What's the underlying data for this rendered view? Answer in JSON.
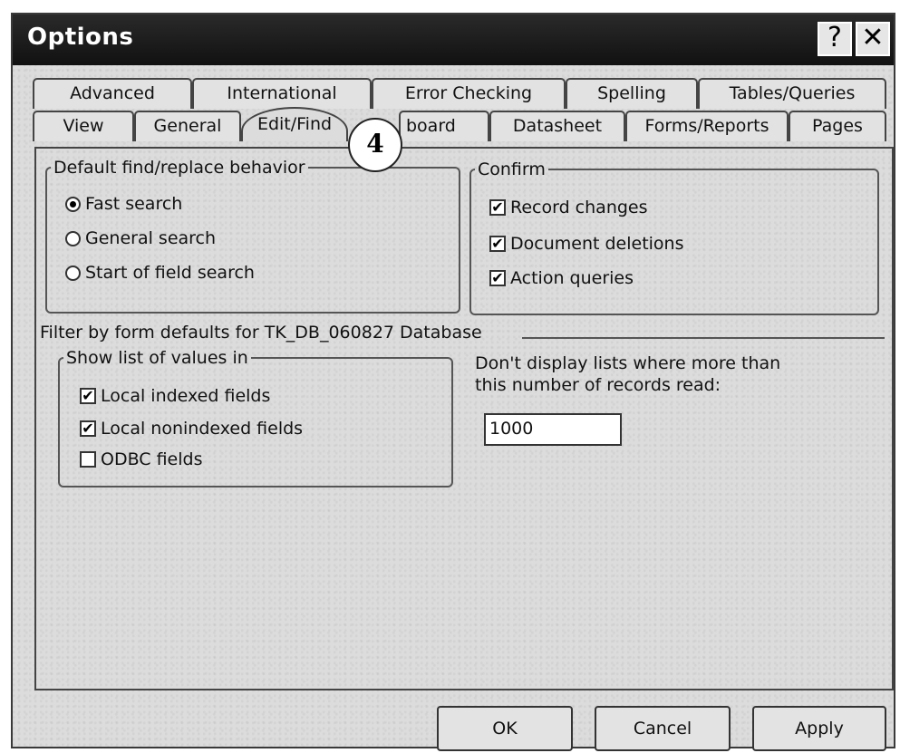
{
  "window": {
    "title": "Options",
    "help_glyph": "?",
    "close_glyph": "✕"
  },
  "tabs": {
    "row1": [
      "Advanced",
      "International",
      "Error Checking",
      "Spelling",
      "Tables/Queries"
    ],
    "row2": [
      "View",
      "General",
      "Edit/Find",
      "Keyboard",
      "Datasheet",
      "Forms/Reports",
      "Pages"
    ],
    "row2_visible": [
      "View",
      "General",
      "Edit/Find",
      "board",
      "Datasheet",
      "Forms/Reports",
      "Pages"
    ],
    "active": "Edit/Find"
  },
  "callout": {
    "number": "4"
  },
  "default_find": {
    "legend": "Default find/replace behavior",
    "options": [
      {
        "label": "Fast search",
        "selected": true
      },
      {
        "label": "General search",
        "selected": false
      },
      {
        "label": "Start of field search",
        "selected": false
      }
    ]
  },
  "confirm": {
    "legend": "Confirm",
    "options": [
      {
        "label": "Record changes",
        "checked": true
      },
      {
        "label": "Document deletions",
        "checked": true
      },
      {
        "label": "Action queries",
        "checked": true
      }
    ]
  },
  "filter": {
    "heading": "Filter by form defaults for TK_DB_060827 Database",
    "show_list": {
      "legend": "Show list of values in",
      "options": [
        {
          "label": "Local indexed fields",
          "checked": true
        },
        {
          "label": "Local nonindexed fields",
          "checked": true
        },
        {
          "label": "ODBC fields",
          "checked": false
        }
      ]
    },
    "records_label_line1": "Don't display lists where more than",
    "records_label_line2": "this number of records read:",
    "records_value": "1000"
  },
  "buttons": {
    "ok": "OK",
    "cancel": "Cancel",
    "apply": "Apply"
  }
}
